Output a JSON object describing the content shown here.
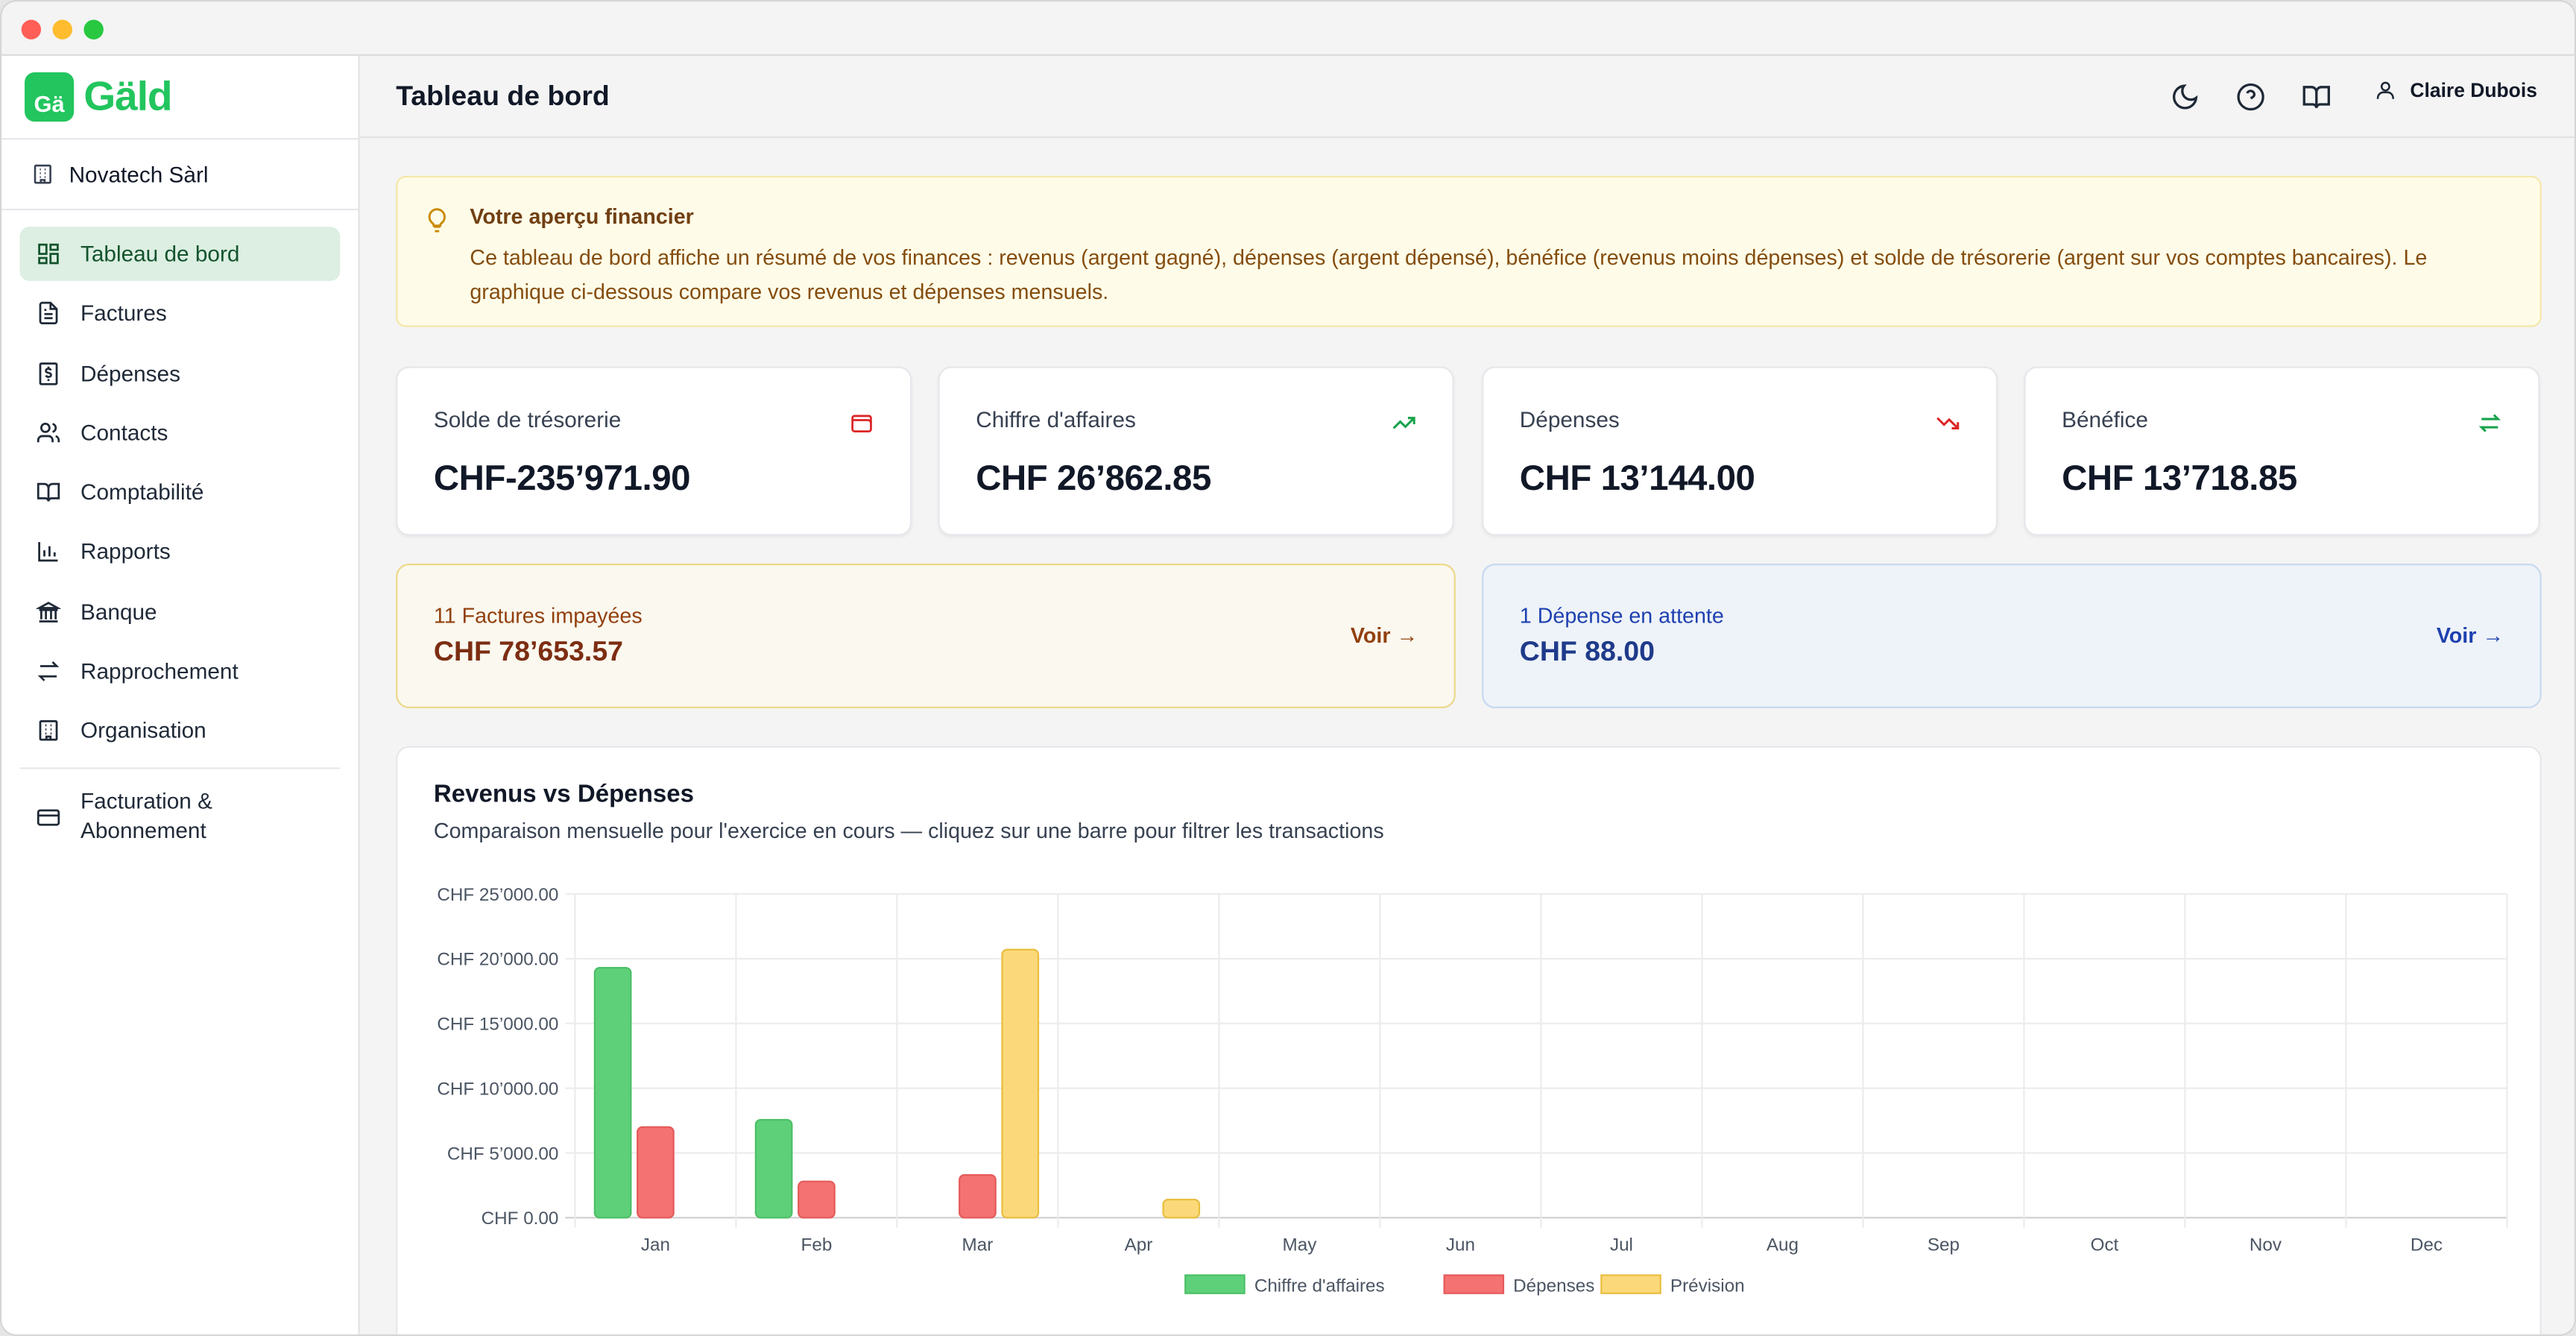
{
  "app": {
    "name": "Gäld",
    "logo_badge": "Gä",
    "organization": "Novatech Sàrl"
  },
  "sidebar": {
    "items": [
      {
        "label": "Tableau de bord",
        "icon": "dashboard-icon",
        "active": true
      },
      {
        "label": "Factures",
        "icon": "file-text-icon"
      },
      {
        "label": "Dépenses",
        "icon": "receipt-icon"
      },
      {
        "label": "Contacts",
        "icon": "users-icon"
      },
      {
        "label": "Comptabilité",
        "icon": "book-icon"
      },
      {
        "label": "Rapports",
        "icon": "bar-chart-icon"
      },
      {
        "label": "Banque",
        "icon": "bank-icon"
      },
      {
        "label": "Rapprochement",
        "icon": "arrows-icon"
      },
      {
        "label": "Organisation",
        "icon": "building-icon"
      }
    ],
    "billing_label": "Facturation & Abonnement"
  },
  "header": {
    "title": "Tableau de bord",
    "user_name": "Claire Dubois"
  },
  "info": {
    "title": "Votre aperçu financier",
    "text": "Ce tableau de bord affiche un résumé de vos finances : revenus (argent gagné), dépenses (argent dépensé), bénéfice (revenus moins dépenses) et solde de trésorerie (argent sur vos comptes bancaires). Le graphique ci-dessous compare vos revenus et dépenses mensuels."
  },
  "kpis": [
    {
      "label": "Solde de trésorerie",
      "value": "CHF-235’971.90",
      "icon": "wallet-icon",
      "color": "#dc2626"
    },
    {
      "label": "Chiffre d'affaires",
      "value": "CHF 26’862.85",
      "icon": "trending-up-icon",
      "color": "#16a34a"
    },
    {
      "label": "Dépenses",
      "value": "CHF 13’144.00",
      "icon": "trending-down-icon",
      "color": "#dc2626"
    },
    {
      "label": "Bénéfice",
      "value": "CHF 13’718.85",
      "icon": "arrows-exchange-icon",
      "color": "#16a34a"
    }
  ],
  "alerts": {
    "unpaid": {
      "title": "11 Factures impayées",
      "amount": "CHF 78’653.57",
      "link": "Voir →"
    },
    "pending": {
      "title": "1 Dépense en attente",
      "amount": "CHF 88.00",
      "link": "Voir →"
    }
  },
  "chart": {
    "title": "Revenus vs Dépenses",
    "subtitle": "Comparaison mensuelle pour l'exercice en cours — cliquez sur une barre pour filtrer les transactions"
  },
  "chart_data": {
    "type": "bar",
    "categories": [
      "Jan",
      "Feb",
      "Mar",
      "Apr",
      "May",
      "Jun",
      "Jul",
      "Aug",
      "Sep",
      "Oct",
      "Nov",
      "Dec"
    ],
    "series": [
      {
        "name": "Chiffre d'affaires",
        "color": "#5fd07a",
        "border": "#4bbf66",
        "values": [
          19300,
          7560,
          0,
          0,
          0,
          0,
          0,
          0,
          0,
          0,
          0,
          0
        ]
      },
      {
        "name": "Dépenses",
        "color": "#f47272",
        "border": "#e55a5a",
        "values": [
          7000,
          2800,
          3300,
          0,
          0,
          0,
          0,
          0,
          0,
          0,
          0,
          0
        ]
      },
      {
        "name": "Prévision",
        "color": "#fbd97a",
        "border": "#e9bd3e",
        "values": [
          0,
          0,
          20700,
          1400,
          0,
          0,
          0,
          0,
          0,
          0,
          0,
          0
        ]
      }
    ],
    "y_ticks": [
      "CHF 0.00",
      "CHF 5’000.00",
      "CHF 10’000.00",
      "CHF 15’000.00",
      "CHF 20’000.00",
      "CHF 25’000.00"
    ],
    "ylim": [
      0,
      25000
    ],
    "grid": true,
    "legend": "bottom-center"
  }
}
